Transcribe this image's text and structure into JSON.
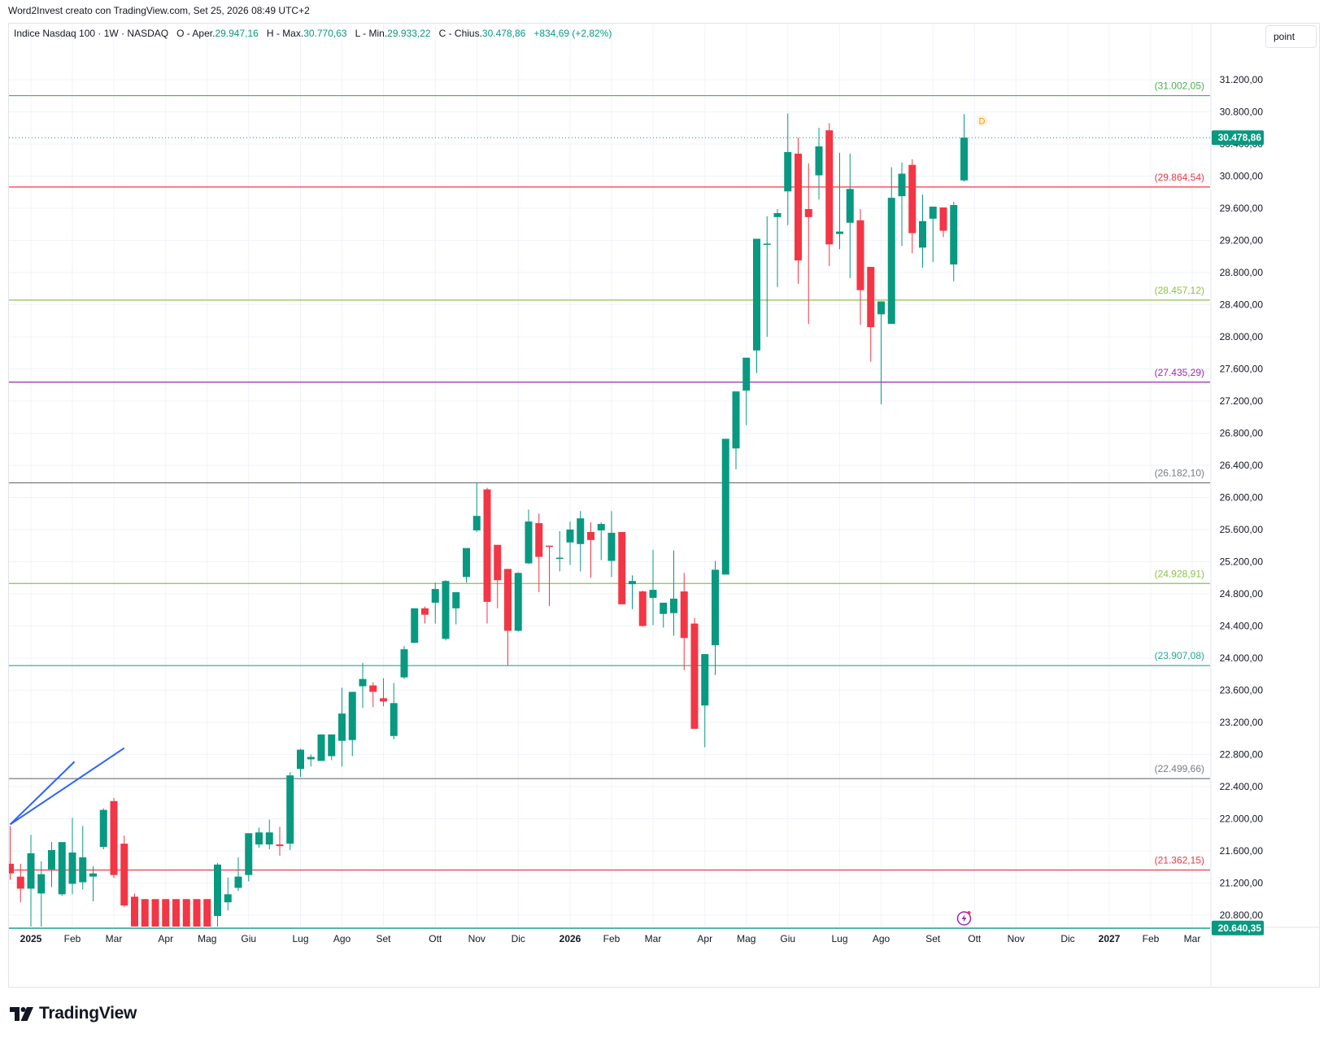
{
  "caption": "Word2Invest creato con TradingView.com, Set 25, 2026 08:49 UTC+2",
  "legend": {
    "symbol": "Indice Nasdaq 100 · 1W · NASDAQ",
    "o_label": "O - Aper.",
    "o": "29.947,16",
    "h_label": "H - Max.",
    "h": "30.770,63",
    "l_label": "L - Min.",
    "l": "29.933,22",
    "c_label": "C - Chius.",
    "c": "30.478,86",
    "change": "+834,69 (+2,82%)"
  },
  "scale_button": "point",
  "brand": "TradingView",
  "colors": {
    "up": "#089981",
    "down": "#f23645",
    "grid": "#f0f3fa",
    "axis_text": "#131722",
    "trendline": "#2962ff"
  },
  "chart_data": {
    "type": "candlestick",
    "y_scale": "linear",
    "y_ticks": [
      "20.800,00",
      "21.200,00",
      "21.600,00",
      "22.000,00",
      "22.400,00",
      "22.800,00",
      "23.200,00",
      "23.600,00",
      "24.000,00",
      "24.400,00",
      "24.800,00",
      "25.200,00",
      "25.600,00",
      "26.000,00",
      "26.400,00",
      "26.800,00",
      "27.200,00",
      "27.600,00",
      "28.000,00",
      "28.400,00",
      "28.800,00",
      "29.200,00",
      "29.600,00",
      "30.000,00",
      "30.400,00",
      "30.800,00",
      "31.200,00"
    ],
    "y_tick_values": [
      20800,
      21200,
      21600,
      22000,
      22400,
      22800,
      23200,
      23600,
      24000,
      24400,
      24800,
      25200,
      25600,
      26000,
      26400,
      26800,
      27200,
      27600,
      28000,
      28400,
      28800,
      29200,
      29600,
      30000,
      30400,
      30800,
      31200
    ],
    "x_labels": [
      {
        "label": "2025",
        "bold": true,
        "week": 2
      },
      {
        "label": "Feb",
        "week": 6
      },
      {
        "label": "Mar",
        "week": 10
      },
      {
        "label": "Apr",
        "week": 15
      },
      {
        "label": "Mag",
        "week": 19
      },
      {
        "label": "Giu",
        "week": 23
      },
      {
        "label": "Lug",
        "week": 28
      },
      {
        "label": "Ago",
        "week": 32
      },
      {
        "label": "Set",
        "week": 36
      },
      {
        "label": "Ott",
        "week": 41
      },
      {
        "label": "Nov",
        "week": 45
      },
      {
        "label": "Dic",
        "week": 49
      },
      {
        "label": "2026",
        "bold": true,
        "week": 54
      },
      {
        "label": "Feb",
        "week": 58
      },
      {
        "label": "Mar",
        "week": 62
      },
      {
        "label": "Apr",
        "week": 67
      },
      {
        "label": "Mag",
        "week": 71
      },
      {
        "label": "Giu",
        "week": 75
      },
      {
        "label": "Lug",
        "week": 80
      },
      {
        "label": "Ago",
        "week": 84
      },
      {
        "label": "Set",
        "week": 89
      },
      {
        "label": "Ott",
        "week": 93
      },
      {
        "label": "Nov",
        "week": 97
      },
      {
        "label": "Dic",
        "week": 102
      },
      {
        "label": "2027",
        "bold": true,
        "week": 106
      },
      {
        "label": "Feb",
        "week": 110
      },
      {
        "label": "Mar",
        "week": 114
      }
    ],
    "levels": [
      {
        "value": 31002.05,
        "label": "(31.002,05)",
        "color": "#4caf50"
      },
      {
        "value": 29864.54,
        "label": "(29.864,54)",
        "color": "#f23645"
      },
      {
        "value": 28457.12,
        "label": "(28.457,12)",
        "color": "#8bc34a"
      },
      {
        "value": 27435.29,
        "label": "(27.435,29)",
        "color": "#9c27b0"
      },
      {
        "value": 26182.1,
        "label": "(26.182,10)",
        "color": "#787b86"
      },
      {
        "value": 24928.91,
        "label": "(24.928,91)",
        "color": "#8bc34a"
      },
      {
        "value": 23907.08,
        "label": "(23.907,08)",
        "color": "#26a69a"
      },
      {
        "value": 22499.66,
        "label": "(22.499,66)",
        "color": "#787b86"
      },
      {
        "value": 21362.15,
        "label": "(21.362,15)",
        "color": "#f23645"
      },
      {
        "value": 20640.35,
        "label": "",
        "color": "#089981"
      }
    ],
    "last_price": {
      "value": 30478.86,
      "label": "30.478,86"
    },
    "low_price": {
      "value": 20640.35,
      "label": "20.640,35"
    },
    "marker_label": "D",
    "trendlines": [
      {
        "from": [
          0.0,
          21930
        ],
        "to": [
          6.2,
          22710
        ]
      },
      {
        "from": [
          0.0,
          21930
        ],
        "to": [
          11.0,
          22880
        ]
      }
    ],
    "candles": [
      [
        21440,
        21910,
        21240,
        21320
      ],
      [
        21280,
        21440,
        20960,
        21130
      ],
      [
        21130,
        21800,
        20630,
        21570
      ],
      [
        21070,
        21470,
        20640,
        21310
      ],
      [
        21370,
        21710,
        21150,
        21610
      ],
      [
        21060,
        21660,
        21040,
        21710
      ],
      [
        21190,
        22010,
        21060,
        21580
      ],
      [
        21210,
        21910,
        21120,
        21520
      ],
      [
        21280,
        21410,
        20970,
        21320
      ],
      [
        21650,
        22130,
        21620,
        22110
      ],
      [
        22220,
        22260,
        21260,
        21300
      ],
      [
        21690,
        21790,
        20900,
        20920
      ],
      [
        21030,
        21070,
        20660,
        20660
      ],
      [
        21000,
        21000,
        20620,
        20640
      ],
      [
        21000,
        21000,
        20620,
        20640
      ],
      [
        21000,
        21000,
        20620,
        20640
      ],
      [
        21000,
        21000,
        20620,
        20640
      ],
      [
        21000,
        21000,
        20620,
        20640
      ],
      [
        21000,
        21000,
        20620,
        20640
      ],
      [
        21000,
        21000,
        20620,
        20640
      ],
      [
        20790,
        21450,
        20640,
        21430
      ],
      [
        20960,
        21270,
        20860,
        21060
      ],
      [
        21140,
        21520,
        21100,
        21280
      ],
      [
        21300,
        21800,
        21220,
        21820
      ],
      [
        21680,
        21890,
        21640,
        21830
      ],
      [
        21680,
        21990,
        21620,
        21830
      ],
      [
        21680,
        21900,
        21540,
        21660
      ],
      [
        21690,
        22580,
        21610,
        22540
      ],
      [
        22620,
        22870,
        22520,
        22860
      ],
      [
        22740,
        22800,
        22650,
        22770
      ],
      [
        22720,
        22800,
        22740,
        23050
      ],
      [
        22780,
        23000,
        22730,
        23050
      ],
      [
        22970,
        23630,
        22650,
        23310
      ],
      [
        22980,
        23570,
        22780,
        23580
      ],
      [
        23650,
        23940,
        23380,
        23740
      ],
      [
        23660,
        23700,
        23390,
        23580
      ],
      [
        23500,
        23750,
        23400,
        23460
      ],
      [
        23030,
        23690,
        22990,
        23440
      ],
      [
        23760,
        24150,
        23740,
        24110
      ],
      [
        24190,
        24620,
        24190,
        24620
      ],
      [
        24620,
        24640,
        24430,
        24540
      ],
      [
        24690,
        24940,
        24430,
        24860
      ],
      [
        24240,
        24970,
        24220,
        24960
      ],
      [
        24620,
        24800,
        24420,
        24820
      ],
      [
        25010,
        25360,
        24940,
        25370
      ],
      [
        25590,
        26180,
        25570,
        25770
      ],
      [
        26100,
        26120,
        24430,
        24700
      ],
      [
        25410,
        25410,
        24620,
        24970
      ],
      [
        25110,
        25110,
        23910,
        24340
      ],
      [
        24340,
        25070,
        24330,
        25060
      ],
      [
        25180,
        25850,
        25170,
        25700
      ],
      [
        25680,
        25800,
        24820,
        25260
      ],
      [
        25400,
        25400,
        24650,
        25390
      ],
      [
        25250,
        25580,
        25080,
        25250
      ],
      [
        25440,
        25700,
        25160,
        25600
      ],
      [
        25420,
        25830,
        25080,
        25740
      ],
      [
        25570,
        25690,
        25000,
        25470
      ],
      [
        25590,
        25690,
        25220,
        25670
      ],
      [
        25210,
        25830,
        25010,
        25560
      ],
      [
        25570,
        25530,
        24970,
        24670
      ],
      [
        24920,
        25030,
        24610,
        24960
      ],
      [
        24830,
        24840,
        24390,
        24400
      ],
      [
        24750,
        25350,
        24410,
        24850
      ],
      [
        24550,
        24570,
        24380,
        24690
      ],
      [
        24560,
        25340,
        24280,
        24740
      ],
      [
        24830,
        25060,
        23850,
        24250
      ],
      [
        24430,
        24500,
        23120,
        23120
      ],
      [
        23410,
        23940,
        22890,
        24050
      ],
      [
        24160,
        25210,
        23790,
        25100
      ],
      [
        25040,
        26690,
        25040,
        26730
      ],
      [
        26610,
        27240,
        26350,
        27320
      ],
      [
        27330,
        27480,
        26900,
        27740
      ],
      [
        27830,
        29220,
        27550,
        29220
      ],
      [
        29150,
        29500,
        28000,
        29160
      ],
      [
        29490,
        29590,
        28620,
        29540
      ],
      [
        29810,
        30780,
        29390,
        30300
      ],
      [
        30280,
        30480,
        28660,
        28950
      ],
      [
        29590,
        30160,
        28160,
        29490
      ],
      [
        30010,
        30600,
        29710,
        30370
      ],
      [
        30570,
        30660,
        28880,
        29150
      ],
      [
        29280,
        30290,
        29090,
        29310
      ],
      [
        29420,
        30280,
        28730,
        29840
      ],
      [
        29450,
        29590,
        28150,
        28580
      ],
      [
        28870,
        28870,
        27690,
        28120
      ],
      [
        28280,
        28390,
        27160,
        28440
      ],
      [
        28160,
        30110,
        28220,
        29730
      ],
      [
        29750,
        30170,
        29130,
        30030
      ],
      [
        30140,
        30210,
        29040,
        29290
      ],
      [
        29110,
        29770,
        28860,
        29440
      ],
      [
        29470,
        29620,
        28930,
        29620
      ],
      [
        29610,
        29550,
        29240,
        29320
      ],
      [
        28900,
        29680,
        28690,
        29640
      ],
      [
        29947.16,
        30770.63,
        29933.22,
        30478.86
      ]
    ]
  }
}
